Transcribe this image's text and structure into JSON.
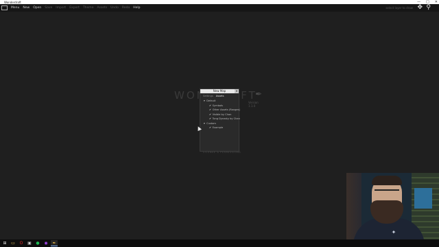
{
  "window": {
    "title": "Wonderdraft",
    "controls": [
      "—",
      "□",
      "✕"
    ]
  },
  "menubar": {
    "logo_label": "",
    "items": [
      {
        "label": "Menu",
        "enabled": true
      },
      {
        "label": "New",
        "enabled": true
      },
      {
        "label": "Open",
        "enabled": true
      },
      {
        "label": "Save",
        "enabled": false
      },
      {
        "label": "Import",
        "enabled": false
      },
      {
        "label": "Export",
        "enabled": false
      },
      {
        "label": "Theme",
        "enabled": false
      },
      {
        "label": "Assets",
        "enabled": false
      },
      {
        "label": "Undo",
        "enabled": false
      },
      {
        "label": "Redo",
        "enabled": false
      },
      {
        "label": "Help",
        "enabled": true
      }
    ],
    "hint": "select layer to draw",
    "tools": {
      "move": "✥",
      "zoom": "⚲"
    }
  },
  "brand": {
    "left_text": "WON",
    "right_text": "AFT",
    "quill": "✒",
    "version": "Version 1.1.0"
  },
  "dialog": {
    "title": "New Map",
    "close": "✕",
    "tabs": [
      "Settings",
      "Assets"
    ],
    "active_tab": "Assets",
    "tree": [
      {
        "kind": "group",
        "arrow": "▾",
        "label": "Default"
      },
      {
        "kind": "child",
        "check": "✔",
        "label": "Symbols"
      },
      {
        "kind": "child",
        "check": "✔",
        "label": "Other Assets (Ranges)"
      },
      {
        "kind": "child",
        "check": "✔",
        "label": "Visible by Chan"
      },
      {
        "kind": "child",
        "check": "✔",
        "label": "Tong Dynasty by Chan"
      },
      {
        "kind": "group",
        "arrow": "▾",
        "label": "Custom"
      },
      {
        "kind": "child",
        "check": "✔",
        "label": "Example"
      }
    ]
  },
  "footer_text": "LICENSE & PERMISSIONS",
  "taskbar": {
    "items": [
      {
        "icon": "windows-icon",
        "glyph": "⊞",
        "color": "#dddddd"
      },
      {
        "icon": "folder-icon",
        "glyph": "▭",
        "color": "#e8c25a"
      },
      {
        "icon": "opera-icon",
        "glyph": "O",
        "color": "#e02b2b"
      },
      {
        "icon": "app-icon",
        "glyph": "▣",
        "color": "#cccccc"
      },
      {
        "icon": "spotify-icon",
        "glyph": "●",
        "color": "#1db954"
      },
      {
        "icon": "media-icon",
        "glyph": "◉",
        "color": "#b04dff"
      },
      {
        "icon": "wonderdraft-icon",
        "glyph": "✒",
        "color": "#e8b84a"
      }
    ]
  }
}
